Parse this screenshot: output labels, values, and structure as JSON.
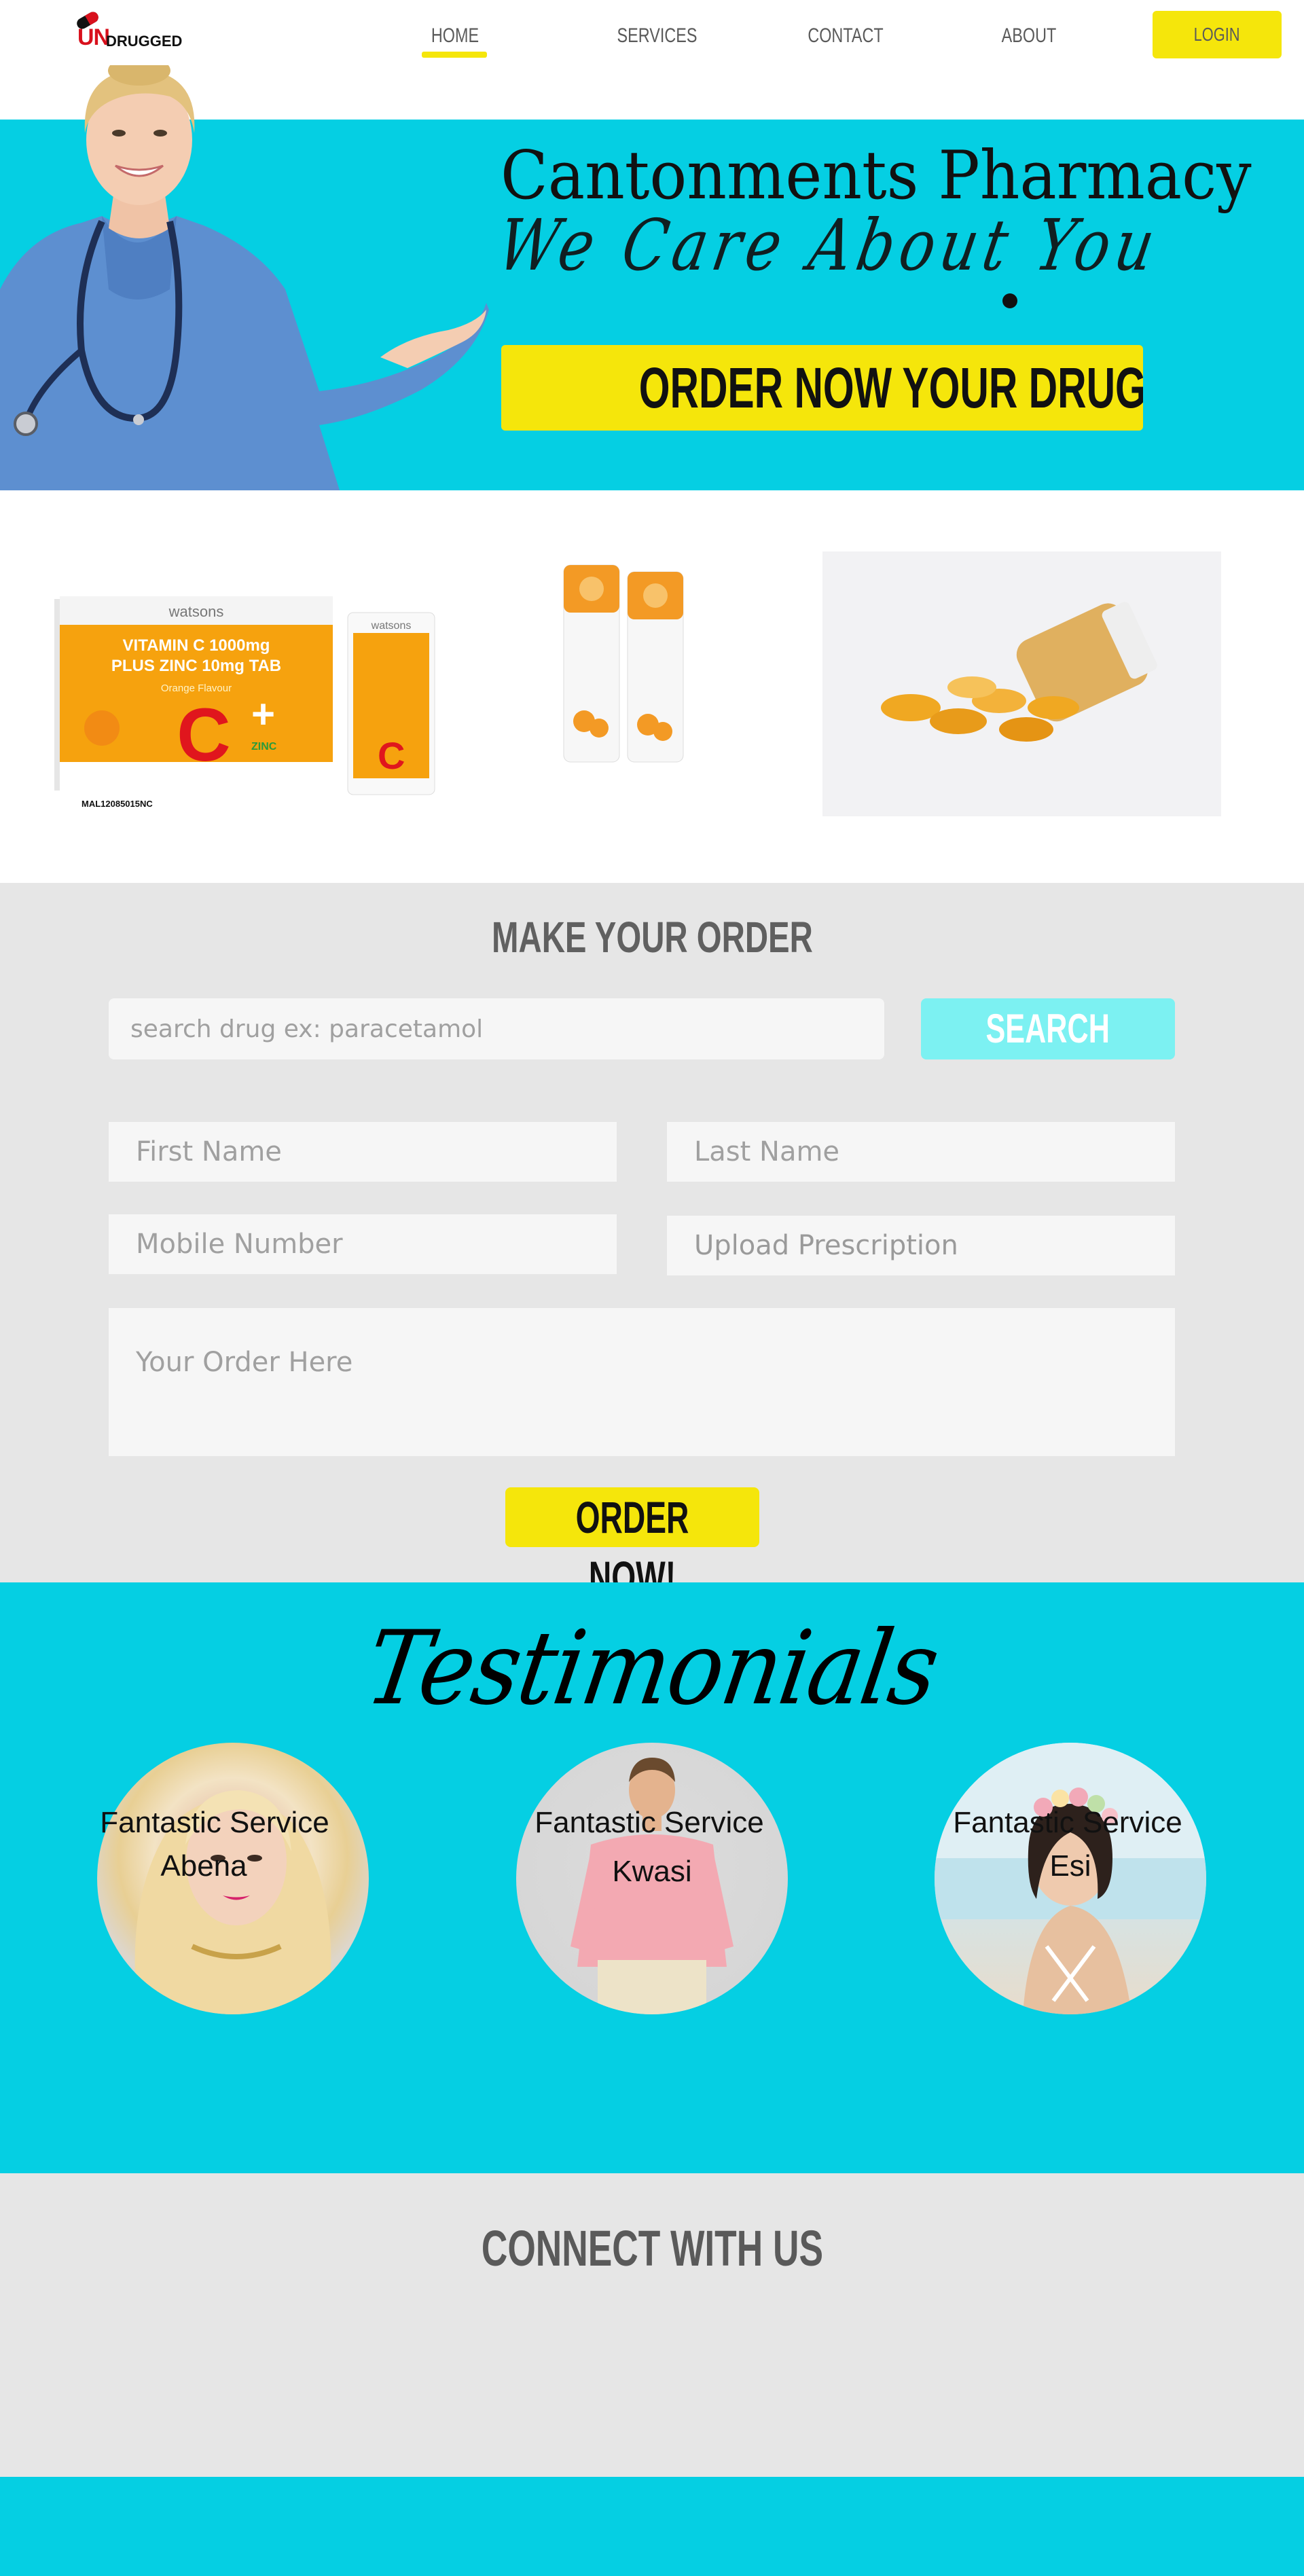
{
  "header": {
    "logo": {
      "un": "UN",
      "rest": "DRUGGED"
    },
    "nav": {
      "home": "HOME",
      "services": "SERVICES",
      "contact": "CONTACT",
      "about": "ABOUT"
    },
    "active_nav": "HOME",
    "login_label": "LOGIN"
  },
  "hero": {
    "title": "Cantonments Pharmacy",
    "tagline": "We Care About You",
    "cta_label": "ORDER NOW YOUR DRUGS NOW"
  },
  "products": {
    "box": {
      "brand": "watsons",
      "line1": "VITAMIN C 1000mg",
      "line2": "PLUS ZINC 10mg TAB",
      "flavour": "Orange Flavour",
      "zinc": "ZINC",
      "code": "MAL12085015NC"
    }
  },
  "order_form": {
    "heading": "MAKE YOUR ORDER",
    "search_placeholder": "search drug ex: paracetamol",
    "search_label": "SEARCH",
    "first_name_placeholder": "First Name",
    "last_name_placeholder": "Last Name",
    "mobile_placeholder": "Mobile Number",
    "upload_label": "Upload Prescription",
    "order_placeholder": "Your Order Here",
    "submit_label": "ORDER NOW!"
  },
  "testimonials": {
    "heading": "Testimonials",
    "items": [
      {
        "caption": "Fantastic Service",
        "name": "Abena"
      },
      {
        "caption": "Fantastic Service",
        "name": "Kwasi"
      },
      {
        "caption": "Fantastic Service",
        "name": "Esi"
      }
    ]
  },
  "connect": {
    "heading": "CONNECT WITH US"
  },
  "colors": {
    "accent_cyan": "#05cfe3",
    "accent_yellow": "#f5e60b",
    "search_button": "#7cf1f2",
    "section_gray": "#e6e6e6"
  }
}
